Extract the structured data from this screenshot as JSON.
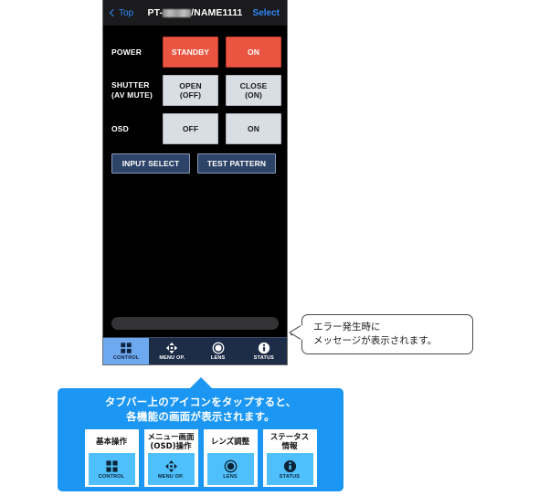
{
  "phone": {
    "navbar": {
      "back_label": "Top",
      "back_icon": "chevron-left-icon",
      "title_prefix": "PT-",
      "title_redacted": "█████",
      "title_suffix": "/NAME1111",
      "select_label": "Select"
    },
    "controls": [
      {
        "label": "POWER",
        "label_sub": "",
        "buttons": [
          {
            "line1": "STANDBY",
            "line2": "",
            "style": "red"
          },
          {
            "line1": "ON",
            "line2": "",
            "style": "red"
          }
        ]
      },
      {
        "label": "SHUTTER",
        "label_sub": "(AV MUTE)",
        "buttons": [
          {
            "line1": "OPEN",
            "line2": "(OFF)",
            "style": "gray"
          },
          {
            "line1": "CLOSE",
            "line2": "(ON)",
            "style": "gray"
          }
        ]
      },
      {
        "label": "OSD",
        "label_sub": "",
        "buttons": [
          {
            "line1": "OFF",
            "line2": "",
            "style": "gray"
          },
          {
            "line1": "ON",
            "line2": "",
            "style": "gray"
          }
        ]
      }
    ],
    "wide_buttons": [
      {
        "label": "INPUT SELECT"
      },
      {
        "label": "TEST PATTERN"
      }
    ],
    "message_bar": {
      "text": ""
    },
    "tabbar": [
      {
        "label": "CONTROL",
        "icon": "grid-icon",
        "active": true
      },
      {
        "label": "MENU OP.",
        "icon": "dpad-arrows-icon",
        "active": false
      },
      {
        "label": "LENS",
        "icon": "lens-circle-icon",
        "active": false
      },
      {
        "label": "STATUS",
        "icon": "info-icon",
        "active": false
      }
    ]
  },
  "callout_error": {
    "line1": "エラー発生時に",
    "line2": "メッセージが表示されます。"
  },
  "callout_tabs": {
    "line1": "タブバー上のアイコンをタップすると、",
    "line2": "各機能の画面が表示されます。",
    "cards": [
      {
        "jp1": "基本操作",
        "jp2": "",
        "en": "CONTROL",
        "icon": "grid-icon"
      },
      {
        "jp1": "メニュー画面",
        "jp2": "(OSD)操作",
        "en": "MENU OP.",
        "icon": "dpad-arrows-icon"
      },
      {
        "jp1": "レンズ調整",
        "jp2": "",
        "en": "LENS",
        "icon": "lens-circle-icon"
      },
      {
        "jp1": "ステータス",
        "jp2": "情報",
        "en": "STATUS",
        "icon": "info-icon"
      }
    ]
  },
  "colors": {
    "accent_blue": "#1b96f3",
    "tab_active": "#6ea8ef",
    "power_red": "#ea5542",
    "button_gray": "#d9dde4",
    "wide_button": "#2d4468",
    "screen_bg": "#000000"
  }
}
